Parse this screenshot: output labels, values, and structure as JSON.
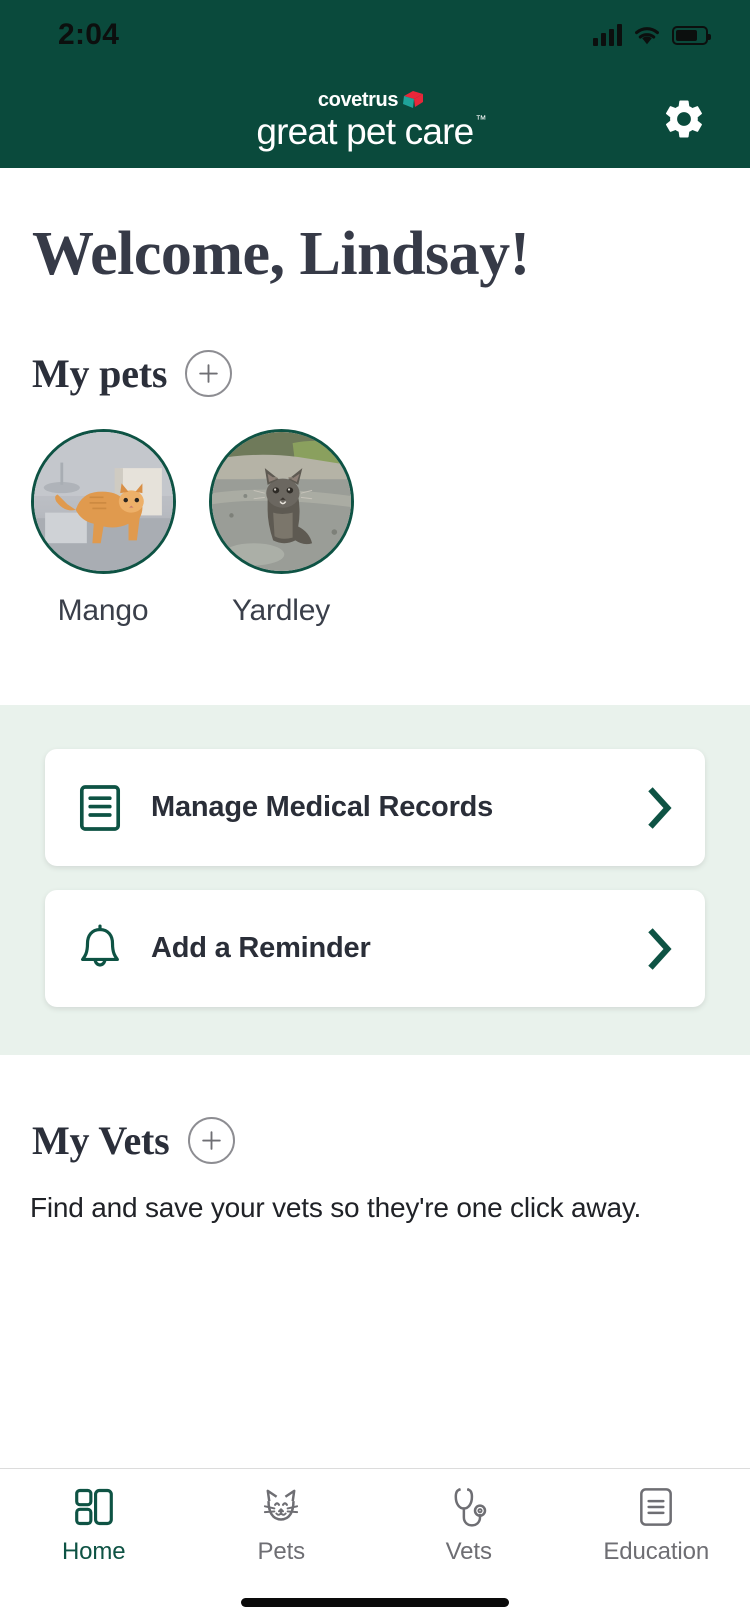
{
  "status_bar": {
    "time": "2:04",
    "signal_icon": "cellular-signal-icon",
    "wifi_icon": "wifi-icon",
    "battery_icon": "battery-icon"
  },
  "header": {
    "brand_top": "covetrus",
    "brand_main": "great pet care",
    "brand_trademark": "™",
    "settings_icon": "gear-icon",
    "background_color": "#0a4a3c",
    "logo_mark_colors": [
      "#e8273a",
      "#1fa39a"
    ]
  },
  "main": {
    "welcome_title": "Welcome, Lindsay!",
    "pets_section": {
      "title": "My pets",
      "add_icon": "plus-circle-icon",
      "pets": [
        {
          "name": "Mango",
          "photo": "orange-tabby-cat-photo"
        },
        {
          "name": "Yardley",
          "photo": "grey-tabby-cat-photo"
        }
      ]
    },
    "quick_actions": {
      "background_color": "#e9f2ec",
      "cards": [
        {
          "label": "Manage Medical Records",
          "icon": "medical-records-document-icon",
          "chevron_icon": "chevron-right-icon"
        },
        {
          "label": "Add a Reminder",
          "icon": "bell-icon",
          "chevron_icon": "chevron-right-icon"
        }
      ]
    },
    "vets_section": {
      "title": "My Vets",
      "add_icon": "plus-circle-icon",
      "description": "Find and save your vets so they're one click away."
    }
  },
  "tab_bar": {
    "active_color": "#0e5344",
    "inactive_color": "#6e6e73",
    "tabs": [
      {
        "label": "Home",
        "icon": "dashboard-grid-icon",
        "active": true
      },
      {
        "label": "Pets",
        "icon": "cat-face-icon",
        "active": false
      },
      {
        "label": "Vets",
        "icon": "stethoscope-icon",
        "active": false
      },
      {
        "label": "Education",
        "icon": "document-lines-icon",
        "active": false
      }
    ]
  }
}
